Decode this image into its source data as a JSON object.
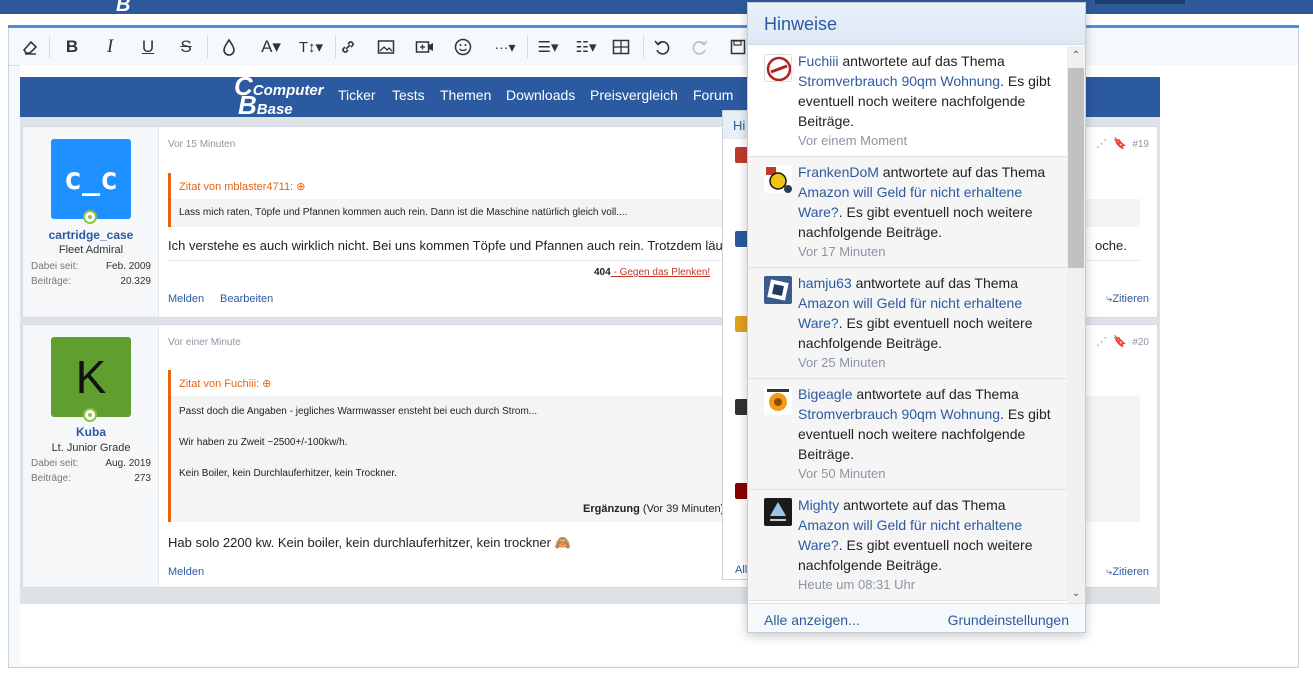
{
  "colors": {
    "brand": "#2c5aa0",
    "quote_accent": "#e8620f",
    "online": "#8bc34a"
  },
  "topbar": {
    "logo_fragment": "B"
  },
  "toolbar": {
    "items": [
      "eraser-icon",
      "bold-icon",
      "italic-icon",
      "underline-icon",
      "strikethrough-icon",
      "text-color-icon",
      "font-family-icon",
      "font-size-icon",
      "link-icon",
      "image-icon",
      "media-icon",
      "smilie-icon",
      "more-icon",
      "align-icon",
      "list-icon",
      "table-icon",
      "undo-icon",
      "redo-icon",
      "save-draft-icon"
    ],
    "glyphs": {
      "bold": "B",
      "italic": "I",
      "underline": "U",
      "strike": "S",
      "font": "A▾",
      "size": "T↕▾",
      "more": "···▾",
      "align": "☰▾",
      "list": "☷▾"
    }
  },
  "site": {
    "logo_line1": "Computer",
    "logo_line2": "Base",
    "nav": [
      "Ticker",
      "Tests",
      "Themen",
      "Downloads",
      "Preisvergleich",
      "Forum"
    ]
  },
  "posts": [
    {
      "author": "cartridge_case",
      "avatar_text": "c_c",
      "rank": "Fleet Admiral",
      "since_label": "Dabei seit:",
      "since": "Feb. 2009",
      "posts_label": "Beiträge:",
      "post_count": "20.329",
      "time": "Vor 15 Minuten",
      "number": "#19",
      "quote_header": "Zitat von mblaster4711:",
      "quote_lines": [
        "Lass mich raten, Töpfe und Pfannen kommen auch rein. Dann ist die Maschine natürlich gleich voll...."
      ],
      "body": "Ich verstehe es auch wirklich nicht. Bei uns kommen Töpfe und Pfannen auch rein. Trotzdem läuft di",
      "body_tail": "oche.",
      "signature_bold": "404",
      "signature_link": " - Gegen das Plenken!",
      "actions": [
        "Melden",
        "Bearbeiten"
      ],
      "quote_action": "Zitieren"
    },
    {
      "author": "Kuba",
      "avatar_text": "K",
      "rank": "Lt. Junior Grade",
      "since_label": "Dabei seit:",
      "since": "Aug. 2019",
      "posts_label": "Beiträge:",
      "post_count": "273",
      "time": "Vor einer Minute",
      "number": "#20",
      "quote_header": "Zitat von Fuchiii:",
      "quote_lines": [
        "Passt doch die Angaben - jegliches Warmwasser ensteht bei euch durch Strom...",
        "Wir haben zu Zweit ~2500+/-100kw/h.",
        "Kein Boiler, kein Durchlauferhitzer, kein Trockner."
      ],
      "edit_bold": "Ergänzung",
      "edit_rest": " (Vor 39 Minuten)",
      "body": "Hab solo 2200 kw. Kein boiler, kein durchlauferhitzer, kein trockner 🙈",
      "actions": [
        "Melden"
      ],
      "quote_action": "Zitieren"
    }
  ],
  "ghost_panel": {
    "title": "Hi",
    "footer": "All"
  },
  "notifications": {
    "title": "Hinweise",
    "items": [
      {
        "user": "Fuchiii",
        "verb": " antwortete auf das Thema ",
        "thread": "Stromverbrauch 90qm Wohnung",
        "rest": ". Es gibt eventuell noch weitere nachfolgende Beiträge.",
        "time": "Vor einem Moment"
      },
      {
        "user": "FrankenDoM",
        "verb": " antwortete auf das Thema ",
        "thread": "Amazon will Geld für nicht erhaltene Ware?",
        "rest": ". Es gibt eventuell noch weitere nachfolgende Beiträge.",
        "time": "Vor 17 Minuten"
      },
      {
        "user": "hamju63",
        "verb": " antwortete auf das Thema ",
        "thread": "Amazon will Geld für nicht erhaltene Ware?",
        "rest": ". Es gibt eventuell noch weitere nachfolgende Beiträge.",
        "time": "Vor 25 Minuten"
      },
      {
        "user": "Bigeagle",
        "verb": " antwortete auf das Thema ",
        "thread": "Stromverbrauch 90qm Wohnung",
        "rest": ". Es gibt eventuell noch weitere nachfolgende Beiträge.",
        "time": "Vor 50 Minuten"
      },
      {
        "user": "Mighty",
        "verb": " antwortete auf das Thema ",
        "thread": "Amazon will Geld für nicht erhaltene Ware?",
        "rest": ". Es gibt eventuell noch weitere nachfolgende Beiträge.",
        "time": "Heute um 08:31 Uhr"
      }
    ],
    "show_all": "Alle anzeigen...",
    "settings": "Grundeinstellungen"
  }
}
